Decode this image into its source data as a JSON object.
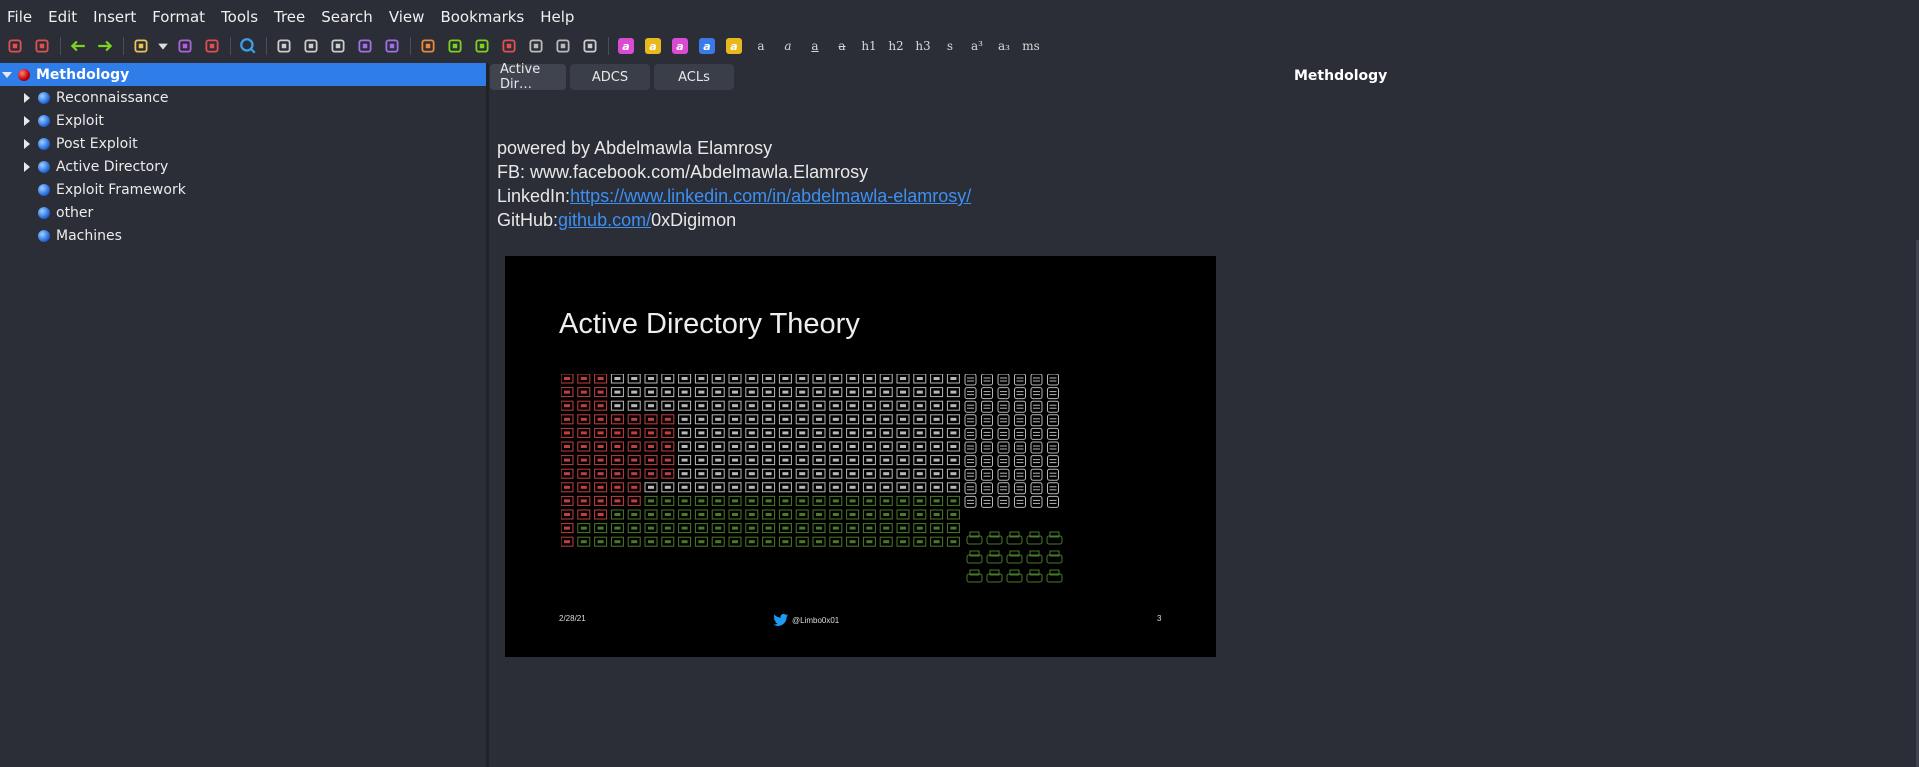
{
  "menu": [
    "File",
    "Edit",
    "Insert",
    "Format",
    "Tools",
    "Tree",
    "Search",
    "View",
    "Bookmarks",
    "Help"
  ],
  "toolbar": {
    "icons": [
      "add-node-icon",
      "add-subnode-icon",
      "back-icon",
      "forward-icon",
      "open-folder-icon",
      "dropdown-arrow-icon",
      "save-icon",
      "export-icon",
      "search-icon",
      "bullet-list-icon",
      "numbered-list-icon",
      "todo-list-icon",
      "indent-icon",
      "unindent-icon",
      "insert-image-icon",
      "insert-table-icon",
      "insert-codebox-icon",
      "insert-anchor-icon",
      "insert-link-icon",
      "link-icon",
      "insert-file-icon"
    ],
    "format_buttons": [
      {
        "name": "fg-color-icon",
        "label": "a",
        "color": "#d94bd2"
      },
      {
        "name": "bg-color-icon",
        "label": "a",
        "color": "#e8b81f"
      },
      {
        "name": "bold-color-icon",
        "label": "a",
        "color": "#d94bd2"
      },
      {
        "name": "italic-color-icon",
        "label": "a",
        "color": "#3a7ae6"
      },
      {
        "name": "highlight-color-icon",
        "label": "a",
        "color": "#e8b81f"
      }
    ],
    "text_buttons": [
      "a",
      "a",
      "a",
      "a",
      "h1",
      "h2",
      "h3",
      "s",
      "a³",
      "a₃",
      "ms"
    ]
  },
  "tree": {
    "root": {
      "label": "Methdology",
      "expanded": true
    },
    "children": [
      {
        "label": "Reconnaissance",
        "has_children": true
      },
      {
        "label": "Exploit",
        "has_children": true
      },
      {
        "label": "Post Exploit",
        "has_children": true
      },
      {
        "label": "Active Directory",
        "has_children": true
      },
      {
        "label": "Exploit Framework",
        "has_children": false
      },
      {
        "label": "other",
        "has_children": false
      },
      {
        "label": "Machines",
        "has_children": false
      }
    ]
  },
  "tabs": [
    "Active Dir…",
    "ADCS",
    "ACLs"
  ],
  "node_title": "Methdology",
  "editor": {
    "line1": "powered by Abdelmawla Elamrosy",
    "line2": "FB: www.facebook.com/Abdelmawla.Elamrosy",
    "line3_prefix": "LinkedIn:",
    "line3_link": "https://www.linkedin.com/in/abdelmawla-elamrosy/",
    "line4_prefix": "GitHub:",
    "line4_link": "github.com/",
    "line4_suffix": "0xDigimon"
  },
  "slide": {
    "title": "Active Directory Theory",
    "date": "2/28/21",
    "handle": "@Limbo0x01",
    "page": "3",
    "colors": {
      "red": "#c04040",
      "gray": "#b8b8b8",
      "green": "#4a7a2a"
    }
  },
  "colors": {
    "selection": "#2f7de8",
    "link": "#3d8ff2",
    "background": "#2b2e36"
  }
}
